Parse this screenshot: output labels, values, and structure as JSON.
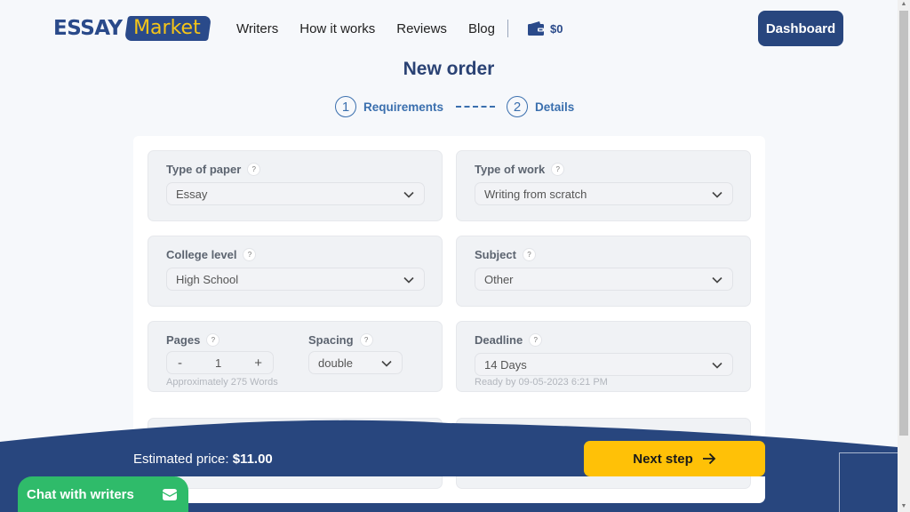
{
  "header": {
    "logo": {
      "part1": "ESSAY",
      "part2": "Market"
    },
    "nav": [
      "Writers",
      "How it works",
      "Reviews",
      "Blog"
    ],
    "wallet_balance": "$0",
    "dashboard_label": "Dashboard"
  },
  "page": {
    "title": "New order",
    "steps": [
      {
        "number": "1",
        "label": "Requirements"
      },
      {
        "number": "2",
        "label": "Details"
      }
    ]
  },
  "form": {
    "type_of_paper": {
      "label": "Type of paper",
      "value": "Essay"
    },
    "type_of_work": {
      "label": "Type of work",
      "value": "Writing from scratch"
    },
    "college_level": {
      "label": "College level",
      "value": "High School"
    },
    "subject": {
      "label": "Subject",
      "value": "Other"
    },
    "pages": {
      "label": "Pages",
      "value": "1",
      "minus": "-",
      "plus": "+",
      "hint": "Approximately 275 Words"
    },
    "spacing": {
      "label": "Spacing",
      "value": "double"
    },
    "deadline": {
      "label": "Deadline",
      "value": "14 Days",
      "hint": "Ready by 09-05-2023 6:21 PM"
    },
    "help_glyph": "?"
  },
  "footer": {
    "price_label": "Estimated price:",
    "price_value": "$11.00",
    "next_label": "Next step",
    "chat_label": "Chat with writers"
  },
  "colors": {
    "brand_navy": "#28467e",
    "accent_yellow": "#ffc107",
    "chat_green": "#2fbb6a",
    "step_blue": "#3a6fae"
  }
}
